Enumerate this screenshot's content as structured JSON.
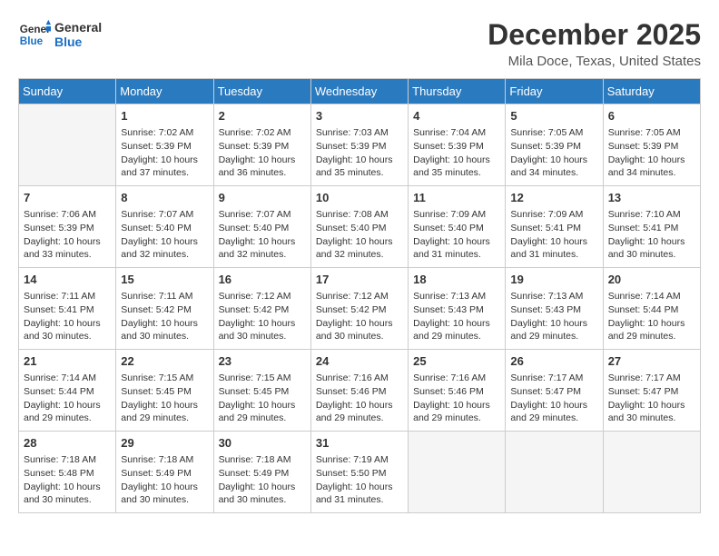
{
  "header": {
    "logo_general": "General",
    "logo_blue": "Blue",
    "month_title": "December 2025",
    "location": "Mila Doce, Texas, United States"
  },
  "days_of_week": [
    "Sunday",
    "Monday",
    "Tuesday",
    "Wednesday",
    "Thursday",
    "Friday",
    "Saturday"
  ],
  "weeks": [
    [
      {
        "day": "",
        "info": ""
      },
      {
        "day": "1",
        "info": "Sunrise: 7:02 AM\nSunset: 5:39 PM\nDaylight: 10 hours\nand 37 minutes."
      },
      {
        "day": "2",
        "info": "Sunrise: 7:02 AM\nSunset: 5:39 PM\nDaylight: 10 hours\nand 36 minutes."
      },
      {
        "day": "3",
        "info": "Sunrise: 7:03 AM\nSunset: 5:39 PM\nDaylight: 10 hours\nand 35 minutes."
      },
      {
        "day": "4",
        "info": "Sunrise: 7:04 AM\nSunset: 5:39 PM\nDaylight: 10 hours\nand 35 minutes."
      },
      {
        "day": "5",
        "info": "Sunrise: 7:05 AM\nSunset: 5:39 PM\nDaylight: 10 hours\nand 34 minutes."
      },
      {
        "day": "6",
        "info": "Sunrise: 7:05 AM\nSunset: 5:39 PM\nDaylight: 10 hours\nand 34 minutes."
      }
    ],
    [
      {
        "day": "7",
        "info": "Sunrise: 7:06 AM\nSunset: 5:39 PM\nDaylight: 10 hours\nand 33 minutes."
      },
      {
        "day": "8",
        "info": "Sunrise: 7:07 AM\nSunset: 5:40 PM\nDaylight: 10 hours\nand 32 minutes."
      },
      {
        "day": "9",
        "info": "Sunrise: 7:07 AM\nSunset: 5:40 PM\nDaylight: 10 hours\nand 32 minutes."
      },
      {
        "day": "10",
        "info": "Sunrise: 7:08 AM\nSunset: 5:40 PM\nDaylight: 10 hours\nand 32 minutes."
      },
      {
        "day": "11",
        "info": "Sunrise: 7:09 AM\nSunset: 5:40 PM\nDaylight: 10 hours\nand 31 minutes."
      },
      {
        "day": "12",
        "info": "Sunrise: 7:09 AM\nSunset: 5:41 PM\nDaylight: 10 hours\nand 31 minutes."
      },
      {
        "day": "13",
        "info": "Sunrise: 7:10 AM\nSunset: 5:41 PM\nDaylight: 10 hours\nand 30 minutes."
      }
    ],
    [
      {
        "day": "14",
        "info": "Sunrise: 7:11 AM\nSunset: 5:41 PM\nDaylight: 10 hours\nand 30 minutes."
      },
      {
        "day": "15",
        "info": "Sunrise: 7:11 AM\nSunset: 5:42 PM\nDaylight: 10 hours\nand 30 minutes."
      },
      {
        "day": "16",
        "info": "Sunrise: 7:12 AM\nSunset: 5:42 PM\nDaylight: 10 hours\nand 30 minutes."
      },
      {
        "day": "17",
        "info": "Sunrise: 7:12 AM\nSunset: 5:42 PM\nDaylight: 10 hours\nand 30 minutes."
      },
      {
        "day": "18",
        "info": "Sunrise: 7:13 AM\nSunset: 5:43 PM\nDaylight: 10 hours\nand 29 minutes."
      },
      {
        "day": "19",
        "info": "Sunrise: 7:13 AM\nSunset: 5:43 PM\nDaylight: 10 hours\nand 29 minutes."
      },
      {
        "day": "20",
        "info": "Sunrise: 7:14 AM\nSunset: 5:44 PM\nDaylight: 10 hours\nand 29 minutes."
      }
    ],
    [
      {
        "day": "21",
        "info": "Sunrise: 7:14 AM\nSunset: 5:44 PM\nDaylight: 10 hours\nand 29 minutes."
      },
      {
        "day": "22",
        "info": "Sunrise: 7:15 AM\nSunset: 5:45 PM\nDaylight: 10 hours\nand 29 minutes."
      },
      {
        "day": "23",
        "info": "Sunrise: 7:15 AM\nSunset: 5:45 PM\nDaylight: 10 hours\nand 29 minutes."
      },
      {
        "day": "24",
        "info": "Sunrise: 7:16 AM\nSunset: 5:46 PM\nDaylight: 10 hours\nand 29 minutes."
      },
      {
        "day": "25",
        "info": "Sunrise: 7:16 AM\nSunset: 5:46 PM\nDaylight: 10 hours\nand 29 minutes."
      },
      {
        "day": "26",
        "info": "Sunrise: 7:17 AM\nSunset: 5:47 PM\nDaylight: 10 hours\nand 29 minutes."
      },
      {
        "day": "27",
        "info": "Sunrise: 7:17 AM\nSunset: 5:47 PM\nDaylight: 10 hours\nand 30 minutes."
      }
    ],
    [
      {
        "day": "28",
        "info": "Sunrise: 7:18 AM\nSunset: 5:48 PM\nDaylight: 10 hours\nand 30 minutes."
      },
      {
        "day": "29",
        "info": "Sunrise: 7:18 AM\nSunset: 5:49 PM\nDaylight: 10 hours\nand 30 minutes."
      },
      {
        "day": "30",
        "info": "Sunrise: 7:18 AM\nSunset: 5:49 PM\nDaylight: 10 hours\nand 30 minutes."
      },
      {
        "day": "31",
        "info": "Sunrise: 7:19 AM\nSunset: 5:50 PM\nDaylight: 10 hours\nand 31 minutes."
      },
      {
        "day": "",
        "info": ""
      },
      {
        "day": "",
        "info": ""
      },
      {
        "day": "",
        "info": ""
      }
    ]
  ]
}
